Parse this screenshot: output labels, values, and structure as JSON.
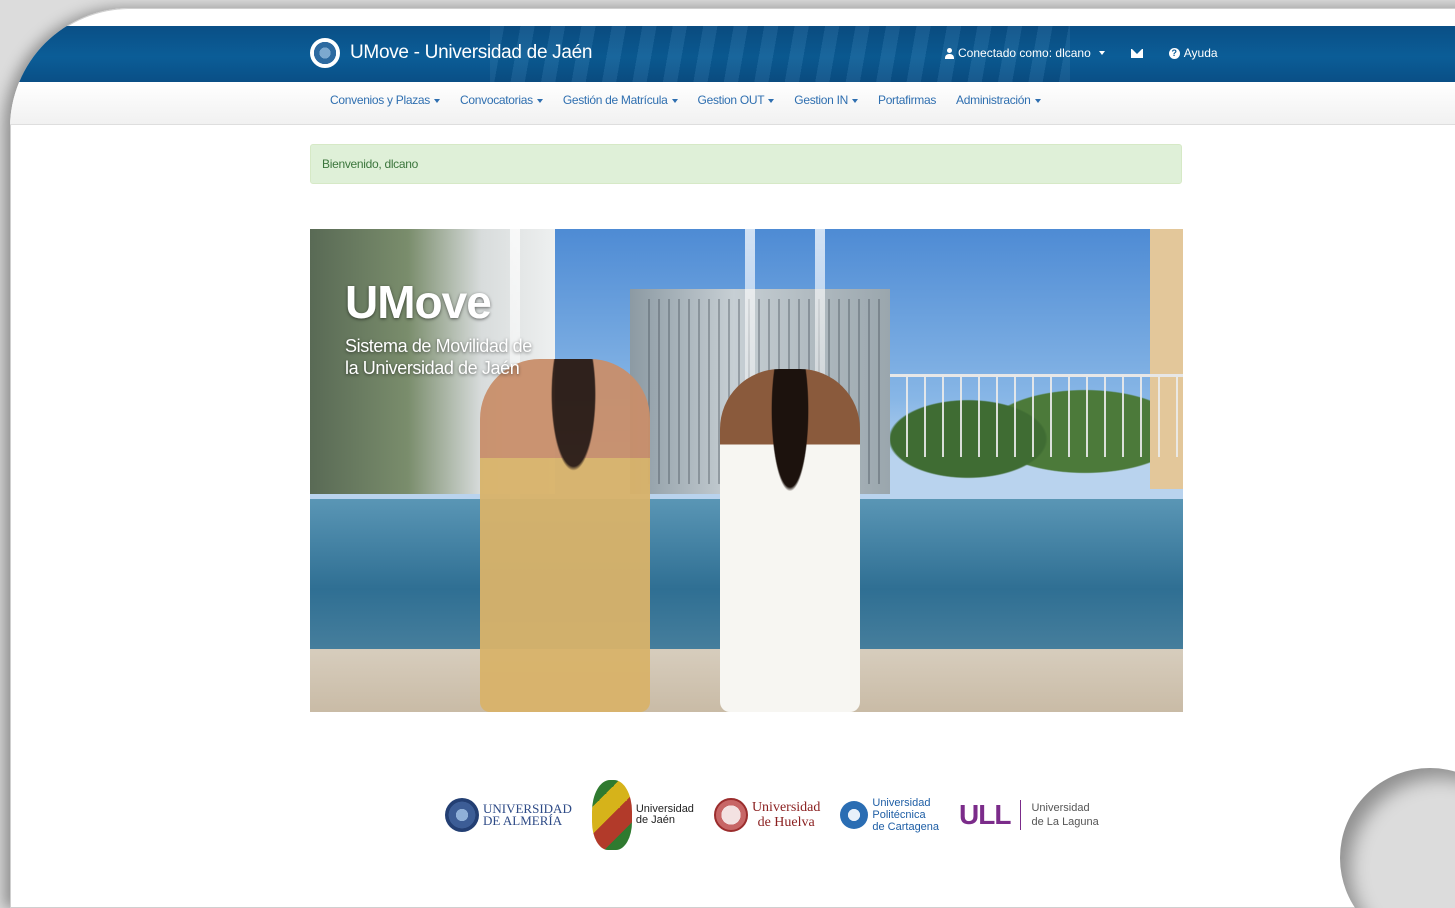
{
  "header": {
    "brand_title": "UMove - Universidad de Jaén",
    "user_label": "Conectado como: dlcano",
    "help_label": "Ayuda",
    "color": "#0b5d97"
  },
  "nav": {
    "items": [
      {
        "label": "Convenios y Plazas",
        "dropdown": true
      },
      {
        "label": "Convocatorias",
        "dropdown": true
      },
      {
        "label": "Gestión de Matrícula",
        "dropdown": true
      },
      {
        "label": "Gestion OUT",
        "dropdown": true
      },
      {
        "label": "Gestion IN",
        "dropdown": true
      },
      {
        "label": "Portafirmas",
        "dropdown": false
      },
      {
        "label": "Administración",
        "dropdown": true
      }
    ],
    "link_color": "#2f6fb0"
  },
  "alert": {
    "message": "Bienvenido, dlcano",
    "color": "#dff0d8"
  },
  "hero": {
    "title": "UMove",
    "subtitle": "Sistema de Movilidad de la Universidad de Jaén"
  },
  "logos": {
    "almeria": {
      "line1": "UNIVERSIDAD",
      "line2": "DE ALMERÍA"
    },
    "jaen": {
      "line1": "Universidad",
      "line2": "de Jaén"
    },
    "huelva": {
      "line1": "Universidad",
      "line2": "de Huelva"
    },
    "cartagena": {
      "line1": "Universidad",
      "line2": "Politécnica",
      "line3": "de Cartagena"
    },
    "laguna": {
      "mark": "ULL",
      "line1": "Universidad",
      "line2": "de La Laguna"
    }
  }
}
